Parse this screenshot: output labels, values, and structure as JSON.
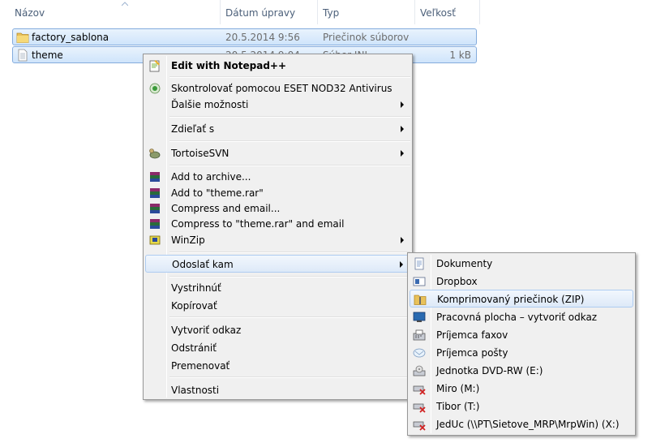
{
  "columns": {
    "name": "Názov",
    "modified": "Dátum úpravy",
    "type": "Typ",
    "size": "Veľkosť"
  },
  "files": [
    {
      "name": "factory_sablona",
      "modified": "20.5.2014 9:56",
      "type": "Priečinok súborov",
      "size": "",
      "icon": "folder-icon"
    },
    {
      "name": "theme",
      "modified": "20.5.2014 9:04",
      "type": "Súbor INI",
      "size": "1 kB",
      "icon": "ini-file-icon"
    }
  ],
  "context_menu": {
    "items": [
      {
        "label": "Edit with Notepad++",
        "icon": "notepad-plus-plus-icon"
      },
      {
        "label": "Skontrolovať pomocou ESET NOD32 Antivirus",
        "icon": "eset-icon"
      },
      {
        "label": "Ďalšie možnosti"
      },
      {
        "label": "Zdieľať s"
      },
      {
        "label": "TortoiseSVN",
        "icon": "tortoisesvn-icon"
      },
      {
        "label": "Add to archive...",
        "icon": "winrar-icon"
      },
      {
        "label": "Add to \"theme.rar\"",
        "icon": "winrar-icon"
      },
      {
        "label": "Compress and email...",
        "icon": "winrar-icon"
      },
      {
        "label": "Compress to \"theme.rar\" and email",
        "icon": "winrar-icon"
      },
      {
        "label": "WinZip",
        "icon": "winzip-icon"
      },
      {
        "label": "Odoslať kam"
      },
      {
        "label": "Vystrihnúť"
      },
      {
        "label": "Kopírovať"
      },
      {
        "label": "Vytvoriť odkaz"
      },
      {
        "label": "Odstrániť"
      },
      {
        "label": "Premenovať"
      },
      {
        "label": "Vlastnosti"
      }
    ]
  },
  "send_to_menu": {
    "items": [
      {
        "label": "Dokumenty",
        "icon": "documents-icon"
      },
      {
        "label": "Dropbox",
        "icon": "dropbox-icon"
      },
      {
        "label": "Komprimovaný priečinok (ZIP)",
        "icon": "zip-folder-icon"
      },
      {
        "label": "Pracovná plocha – vytvoriť odkaz",
        "icon": "desktop-icon"
      },
      {
        "label": "Príjemca faxov",
        "icon": "fax-icon"
      },
      {
        "label": "Príjemca pošty",
        "icon": "mail-icon"
      },
      {
        "label": "Jednotka DVD-RW (E:)",
        "icon": "dvd-drive-icon"
      },
      {
        "label": "Miro (M:)",
        "icon": "network-drive-disconnected-icon"
      },
      {
        "label": "Tibor (T:)",
        "icon": "network-drive-disconnected-icon"
      },
      {
        "label": "JedUc (\\\\PT\\Sietove_MRP\\MrpWin) (X:)",
        "icon": "network-drive-disconnected-icon"
      }
    ]
  },
  "colors": {
    "selection": "#cfe4fb",
    "menu_background": "#f0f0f0",
    "header_text": "#4c607a"
  }
}
